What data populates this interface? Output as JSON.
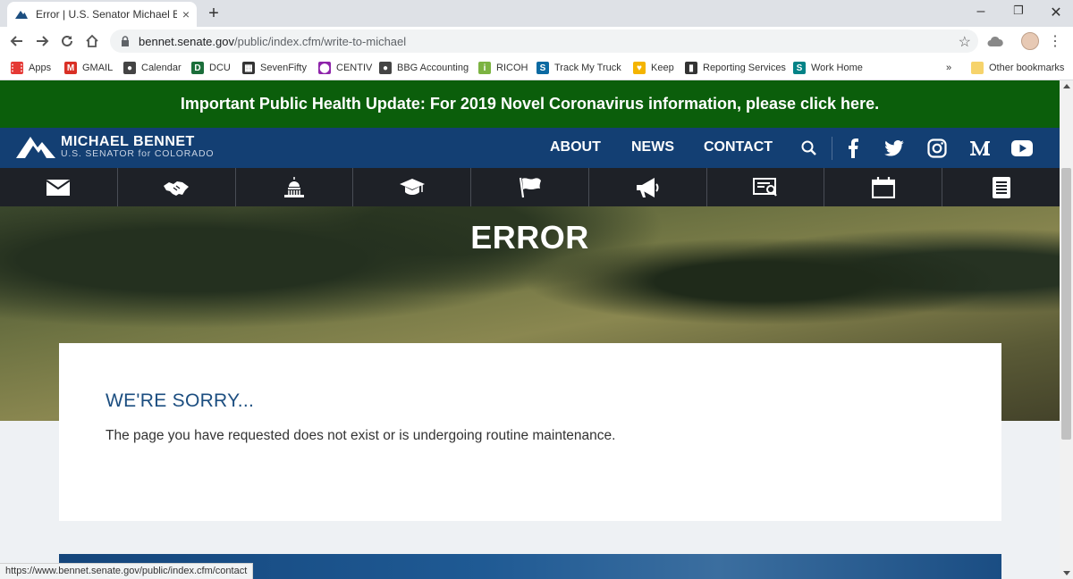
{
  "browser": {
    "tab_title": "Error | U.S. Senator Michael Bennet",
    "tab_close": "×",
    "new_tab": "+",
    "window_minimize": "–",
    "window_restore": "❐",
    "window_close": "✕",
    "url_host": "bennet.senate.gov",
    "url_path": "/public/index.cfm/write-to-michael",
    "status_url": "https://www.bennet.senate.gov/public/index.cfm/contact"
  },
  "bookmarks": [
    {
      "label": "Apps",
      "icon": "apps-grid-icon",
      "color": "#e53935"
    },
    {
      "label": "GMAIL",
      "icon": "gmail-icon",
      "color": "#d93025"
    },
    {
      "label": "Calendar",
      "icon": "globe-icon",
      "color": "#444444"
    },
    {
      "label": "DCU",
      "icon": "dcu-icon",
      "color": "#1b6e3a"
    },
    {
      "label": "SevenFifty",
      "icon": "checker-icon",
      "color": "#333333"
    },
    {
      "label": "CENTIV",
      "icon": "pin-icon",
      "color": "#8e24aa"
    },
    {
      "label": "BBG Accounting",
      "icon": "globe-icon",
      "color": "#444444"
    },
    {
      "label": "RICOH",
      "icon": "ricoh-icon",
      "color": "#7cb342"
    },
    {
      "label": "Track My Truck",
      "icon": "sharepoint-icon",
      "color": "#0b6aa2"
    },
    {
      "label": "Keep",
      "icon": "keep-icon",
      "color": "#f4b400"
    },
    {
      "label": "Reporting Services",
      "icon": "chart-icon",
      "color": "#333333"
    },
    {
      "label": "Work Home",
      "icon": "sharepoint-icon",
      "color": "#038387"
    }
  ],
  "bookmarks_more": "»",
  "other_bookmarks": "Other bookmarks",
  "alert": {
    "text": "Important Public Health Update: For 2019 Novel Coronavirus information, please click here."
  },
  "site": {
    "logo_name": "MICHAEL BENNET",
    "logo_sub": "U.S. SENATOR for COLORADO",
    "nav": [
      "ABOUT",
      "NEWS",
      "CONTACT"
    ],
    "social": [
      "search-icon",
      "facebook-icon",
      "twitter-icon",
      "instagram-icon",
      "medium-icon",
      "youtube-icon"
    ]
  },
  "iconbar": [
    "envelope-icon",
    "handshake-icon",
    "capitol-icon",
    "graduation-cap-icon",
    "flag-icon",
    "megaphone-icon",
    "certificate-icon",
    "calendar-icon",
    "document-icon"
  ],
  "hero": {
    "title": "ERROR"
  },
  "card": {
    "heading": "WE'RE SORRY...",
    "body": "The page you have requested does not exist or is undergoing routine maintenance."
  },
  "colors": {
    "alert_green": "#0b5e0b",
    "header_blue": "#133f73",
    "iconbar_dark": "#1e2127",
    "heading_blue": "#1c4e80"
  }
}
